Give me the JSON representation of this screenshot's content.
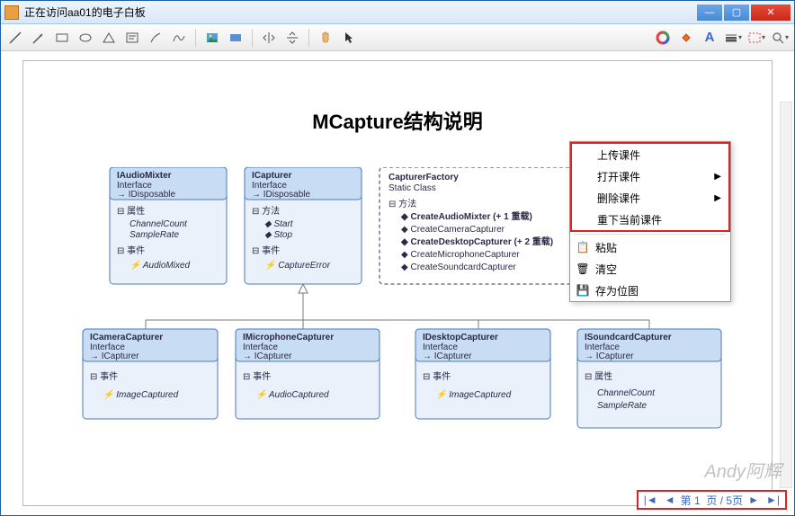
{
  "window": {
    "title": "正在访问aa01的电子白板"
  },
  "doc": {
    "title": "MCapture结构说明"
  },
  "toolbar_icons": [
    "line",
    "arrow",
    "rect",
    "ellipse",
    "triangle",
    "text",
    "path",
    "curl",
    "image",
    "clip",
    "flip-h",
    "flip-v",
    "hand",
    "pointer",
    "color-wheel",
    "fill",
    "font",
    "lines",
    "select-dash",
    "zoom"
  ],
  "menu": {
    "group1": [
      {
        "label": "上传课件",
        "arrow": false
      },
      {
        "label": "打开课件",
        "arrow": true
      },
      {
        "label": "删除课件",
        "arrow": true
      },
      {
        "label": "重下当前课件",
        "arrow": false
      }
    ],
    "group2": [
      {
        "label": "粘贴",
        "icon": "paste"
      },
      {
        "label": "清空",
        "icon": "trash"
      },
      {
        "label": "存为位图",
        "icon": "save"
      }
    ]
  },
  "diagram": {
    "IAudioMixter": {
      "stereo": "Interface",
      "impl": "IDisposable",
      "sections": [
        {
          "h": "属性",
          "items": [
            "ChannelCount",
            "SampleRate"
          ]
        },
        {
          "h": "事件",
          "items": [
            "AudioMixed"
          ]
        }
      ]
    },
    "ICapturer": {
      "stereo": "Interface",
      "impl": "IDisposable",
      "sections": [
        {
          "h": "方法",
          "items": [
            "Start",
            "Stop"
          ]
        },
        {
          "h": "事件",
          "items": [
            "CaptureError"
          ]
        }
      ]
    },
    "CapturerFactory": {
      "stereo": "Static Class",
      "h": "方法",
      "items": [
        "CreateAudioMixter (+ 1 重载)",
        "CreateCameraCapturer",
        "CreateDesktopCapturer (+ 2 重载)",
        "CreateMicrophoneCapturer",
        "CreateSoundcardCapturer"
      ]
    },
    "ICameraCapturer": {
      "stereo": "Interface",
      "impl": "ICapturer",
      "sections": [
        {
          "h": "事件",
          "items": [
            "ImageCaptured"
          ]
        }
      ]
    },
    "IMicrophoneCapturer": {
      "stereo": "Interface",
      "impl": "ICapturer",
      "sections": [
        {
          "h": "事件",
          "items": [
            "AudioCaptured"
          ]
        }
      ]
    },
    "IDesktopCapturer": {
      "stereo": "Interface",
      "impl": "ICapturer",
      "sections": [
        {
          "h": "事件",
          "items": [
            "ImageCaptured"
          ]
        }
      ]
    },
    "ISoundcardCapturer": {
      "stereo": "Interface",
      "impl": "ICapturer",
      "sections": [
        {
          "h": "属性",
          "items": [
            "ChannelCount",
            "SampleRate"
          ]
        }
      ]
    }
  },
  "pager": {
    "prefix": "第",
    "page": "1",
    "mid": "页",
    "sep": "/",
    "total": "5页"
  },
  "watermark": "Andy阿辉"
}
